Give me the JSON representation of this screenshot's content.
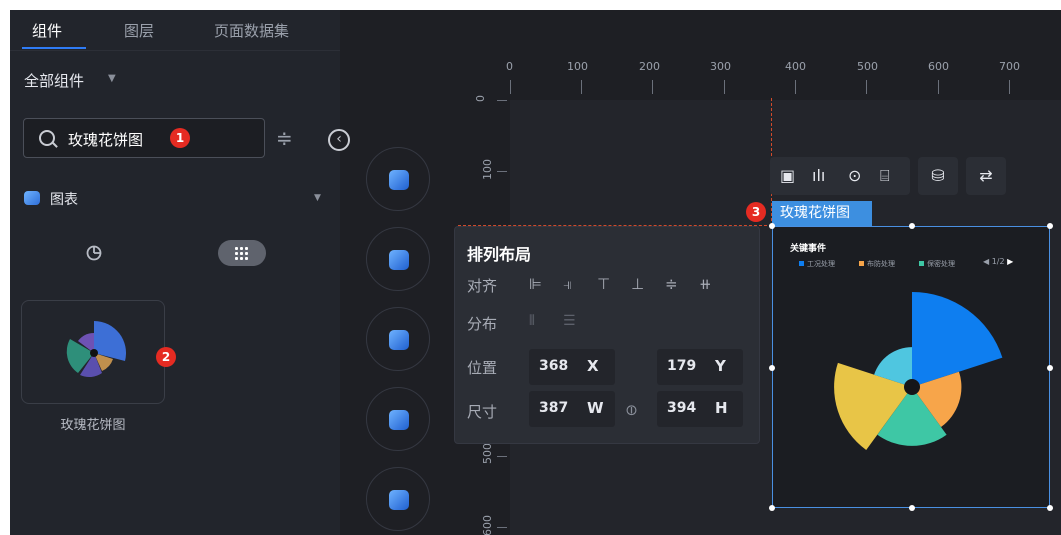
{
  "left_panel": {
    "tabs": [
      {
        "label": "组件",
        "active": true
      },
      {
        "label": "图层",
        "active": false
      },
      {
        "label": "页面数据集",
        "active": false
      }
    ],
    "all_components_label": "全部组件",
    "search": {
      "value": "玫瑰花饼图",
      "placeholder": ""
    },
    "category_label": "图表",
    "component_card_label": "玫瑰花饼图",
    "badges": [
      "1",
      "2",
      "3"
    ]
  },
  "ruler": {
    "top_ticks": [
      "0",
      "100",
      "200",
      "300",
      "400",
      "500",
      "600",
      "700"
    ],
    "left_ticks": [
      "0",
      "100",
      "500",
      "600"
    ]
  },
  "arrange_panel": {
    "title": "排列布局",
    "align_label": "对齐",
    "distribute_label": "分布",
    "position_label": "位置",
    "size_label": "尺寸",
    "x_value": "368",
    "x_axis": "X",
    "y_value": "179",
    "y_axis": "Y",
    "w_value": "387",
    "w_axis": "W",
    "h_value": "394",
    "h_axis": "H"
  },
  "widget": {
    "name_tag": "玫瑰花饼图",
    "toolbar_icons": [
      "image-icon",
      "bar-chart-icon",
      "target-icon",
      "chart-config-icon",
      "database-icon",
      "link-swap-icon"
    ],
    "chart_title": "关键事件",
    "legend": [
      {
        "label": "工况处理",
        "color": "#0e7ef0"
      },
      {
        "label": "布防处理",
        "color": "#f7a54a"
      },
      {
        "label": "保密处理",
        "color": "#3ec7a5"
      }
    ],
    "pager": "1/2",
    "colors": {
      "accent": "#2f7cf6",
      "selection": "#4a90e2",
      "badge": "#e52b22",
      "guide": "#d24a2a"
    }
  },
  "chart_data": {
    "type": "pie",
    "variant": "rose",
    "title": "关键事件",
    "slices": [
      {
        "label": "",
        "value": 100,
        "color": "#0e7ef0"
      },
      {
        "label": "",
        "value": 52,
        "color": "#f7a54a"
      },
      {
        "label": "",
        "value": 62,
        "color": "#3ec7a5"
      },
      {
        "label": "",
        "value": 82,
        "color": "#e8c547"
      },
      {
        "label": "",
        "value": 42,
        "color": "#4fc6e0"
      }
    ],
    "legend_position": "top"
  }
}
